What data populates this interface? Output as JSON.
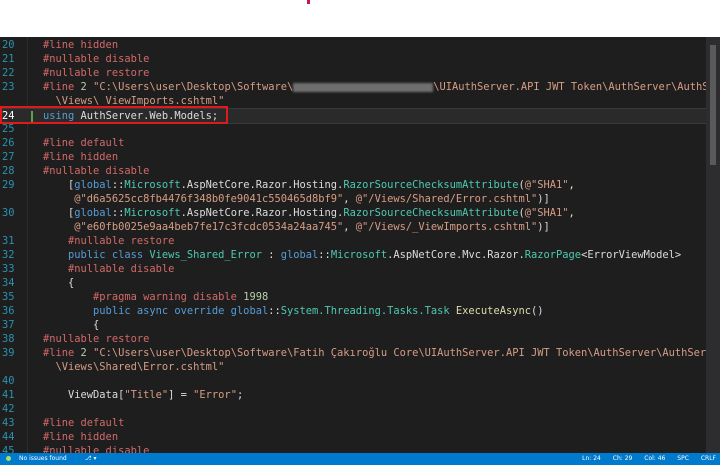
{
  "editor": {
    "lines": [
      {
        "n": "20",
        "segments": [
          {
            "c": "pre",
            "t": "#line hidden"
          }
        ]
      },
      {
        "n": "21",
        "segments": [
          {
            "c": "pre",
            "t": "#nullable disable"
          }
        ]
      },
      {
        "n": "22",
        "segments": [
          {
            "c": "pre",
            "t": "#nullable restore"
          }
        ]
      },
      {
        "n": "23",
        "segments": [
          {
            "c": "pre",
            "t": "#line "
          },
          {
            "c": "num",
            "t": "2"
          },
          {
            "c": "str",
            "t": " \"C:\\Users\\user\\Desktop\\Software\\"
          },
          {
            "c": "redact",
            "t": ""
          },
          {
            "c": "str",
            "t": "\\UIAuthServer.API JWT Token\\AuthServer\\AuthServer.Web"
          }
        ]
      },
      {
        "n": "",
        "segments": [
          {
            "c": "str",
            "t": "  \\Views\\_ViewImports.cshtml\""
          }
        ]
      },
      {
        "n": "24",
        "segments": [
          {
            "c": "kw",
            "t": "using "
          },
          {
            "c": "plain",
            "t": "AuthServer.Web.Models;"
          }
        ],
        "current": true
      },
      {
        "n": "25",
        "segments": []
      },
      {
        "n": "26",
        "segments": [
          {
            "c": "pre",
            "t": "#line default"
          }
        ]
      },
      {
        "n": "27",
        "segments": [
          {
            "c": "pre",
            "t": "#line hidden"
          }
        ]
      },
      {
        "n": "28",
        "segments": [
          {
            "c": "pre",
            "t": "#nullable disable"
          }
        ]
      },
      {
        "n": "29",
        "segments": [
          {
            "c": "plain",
            "t": "    ["
          },
          {
            "c": "kw",
            "t": "global"
          },
          {
            "c": "plain",
            "t": "::"
          },
          {
            "c": "ty",
            "t": "Microsoft"
          },
          {
            "c": "plain",
            "t": ".AspNetCore.Razor.Hosting."
          },
          {
            "c": "ty",
            "t": "RazorSourceChecksumAttribute"
          },
          {
            "c": "plain",
            "t": "("
          },
          {
            "c": "str",
            "t": "@\"SHA1\""
          },
          {
            "c": "plain",
            "t": ","
          }
        ]
      },
      {
        "n": "",
        "segments": [
          {
            "c": "plain",
            "t": "     "
          },
          {
            "c": "str",
            "t": "@\"d6a5625cc8fb4476f348b0fe9041c550465d8bf9\""
          },
          {
            "c": "plain",
            "t": ", "
          },
          {
            "c": "str",
            "t": "@\"/Views/Shared/Error.cshtml\""
          },
          {
            "c": "plain",
            "t": ")]"
          }
        ]
      },
      {
        "n": "30",
        "segments": [
          {
            "c": "plain",
            "t": "    ["
          },
          {
            "c": "kw",
            "t": "global"
          },
          {
            "c": "plain",
            "t": "::"
          },
          {
            "c": "ty",
            "t": "Microsoft"
          },
          {
            "c": "plain",
            "t": ".AspNetCore.Razor.Hosting."
          },
          {
            "c": "ty",
            "t": "RazorSourceChecksumAttribute"
          },
          {
            "c": "plain",
            "t": "("
          },
          {
            "c": "str",
            "t": "@\"SHA1\""
          },
          {
            "c": "plain",
            "t": ","
          }
        ]
      },
      {
        "n": "",
        "segments": [
          {
            "c": "plain",
            "t": "     "
          },
          {
            "c": "str",
            "t": "@\"e60fb0025e9aa4beb7fe17c3fcdc0534a24aa745\""
          },
          {
            "c": "plain",
            "t": ", "
          },
          {
            "c": "str",
            "t": "@\"/Views/_ViewImports.cshtml\""
          },
          {
            "c": "plain",
            "t": ")]"
          }
        ]
      },
      {
        "n": "31",
        "segments": [
          {
            "c": "pre",
            "t": "    #nullable restore"
          }
        ]
      },
      {
        "n": "32",
        "segments": [
          {
            "c": "kw",
            "t": "    public class "
          },
          {
            "c": "ty",
            "t": "Views_Shared_Error"
          },
          {
            "c": "plain",
            "t": " : "
          },
          {
            "c": "kw",
            "t": "global"
          },
          {
            "c": "plain",
            "t": "::"
          },
          {
            "c": "ty",
            "t": "Microsoft"
          },
          {
            "c": "plain",
            "t": ".AspNetCore.Mvc.Razor."
          },
          {
            "c": "ty",
            "t": "RazorPage"
          },
          {
            "c": "plain",
            "t": "<ErrorViewModel>"
          }
        ]
      },
      {
        "n": "33",
        "segments": [
          {
            "c": "pre",
            "t": "    #nullable disable"
          }
        ]
      },
      {
        "n": "34",
        "segments": [
          {
            "c": "plain",
            "t": "    {"
          }
        ]
      },
      {
        "n": "35",
        "segments": [
          {
            "c": "pre",
            "t": "        #pragma warning disable "
          },
          {
            "c": "num",
            "t": "1998"
          }
        ]
      },
      {
        "n": "36",
        "segments": [
          {
            "c": "kw",
            "t": "        public async override "
          },
          {
            "c": "kw",
            "t": "global"
          },
          {
            "c": "plain",
            "t": "::"
          },
          {
            "c": "ty",
            "t": "System.Threading.Tasks.Task"
          },
          {
            "c": "plain",
            "t": " "
          },
          {
            "c": "fn",
            "t": "ExecuteAsync"
          },
          {
            "c": "plain",
            "t": "()"
          }
        ]
      },
      {
        "n": "37",
        "segments": [
          {
            "c": "plain",
            "t": "        {"
          }
        ]
      },
      {
        "n": "38",
        "segments": [
          {
            "c": "pre",
            "t": "#nullable restore"
          }
        ]
      },
      {
        "n": "39",
        "segments": [
          {
            "c": "pre",
            "t": "#line "
          },
          {
            "c": "num",
            "t": "2"
          },
          {
            "c": "str",
            "t": " \"C:\\Users\\user\\Desktop\\Software\\Fatih Çakıroğlu Core\\UIAuthServer.API JWT Token\\AuthServer\\AuthServer.Web"
          }
        ]
      },
      {
        "n": "",
        "segments": [
          {
            "c": "str",
            "t": "  \\Views\\Shared\\Error.cshtml\""
          }
        ]
      },
      {
        "n": "40",
        "segments": []
      },
      {
        "n": "41",
        "segments": [
          {
            "c": "plain",
            "t": "    ViewData["
          },
          {
            "c": "str",
            "t": "\"Title\""
          },
          {
            "c": "plain",
            "t": "] = "
          },
          {
            "c": "str",
            "t": "\"Error\""
          },
          {
            "c": "plain",
            "t": ";"
          }
        ]
      },
      {
        "n": "42",
        "segments": []
      },
      {
        "n": "43",
        "segments": [
          {
            "c": "pre",
            "t": "#line default"
          }
        ]
      },
      {
        "n": "44",
        "segments": [
          {
            "c": "pre",
            "t": "#line hidden"
          }
        ]
      },
      {
        "n": "45",
        "segments": [
          {
            "c": "pre",
            "t": "#nullable disable"
          }
        ]
      }
    ]
  },
  "statusbar": {
    "issues": "No issues found",
    "branch": "⎇ ▾",
    "ln": "Ln: 24",
    "ch": "Ch: 29",
    "col": "Col: 46",
    "spc": "SPC",
    "eol": "CRLF"
  }
}
